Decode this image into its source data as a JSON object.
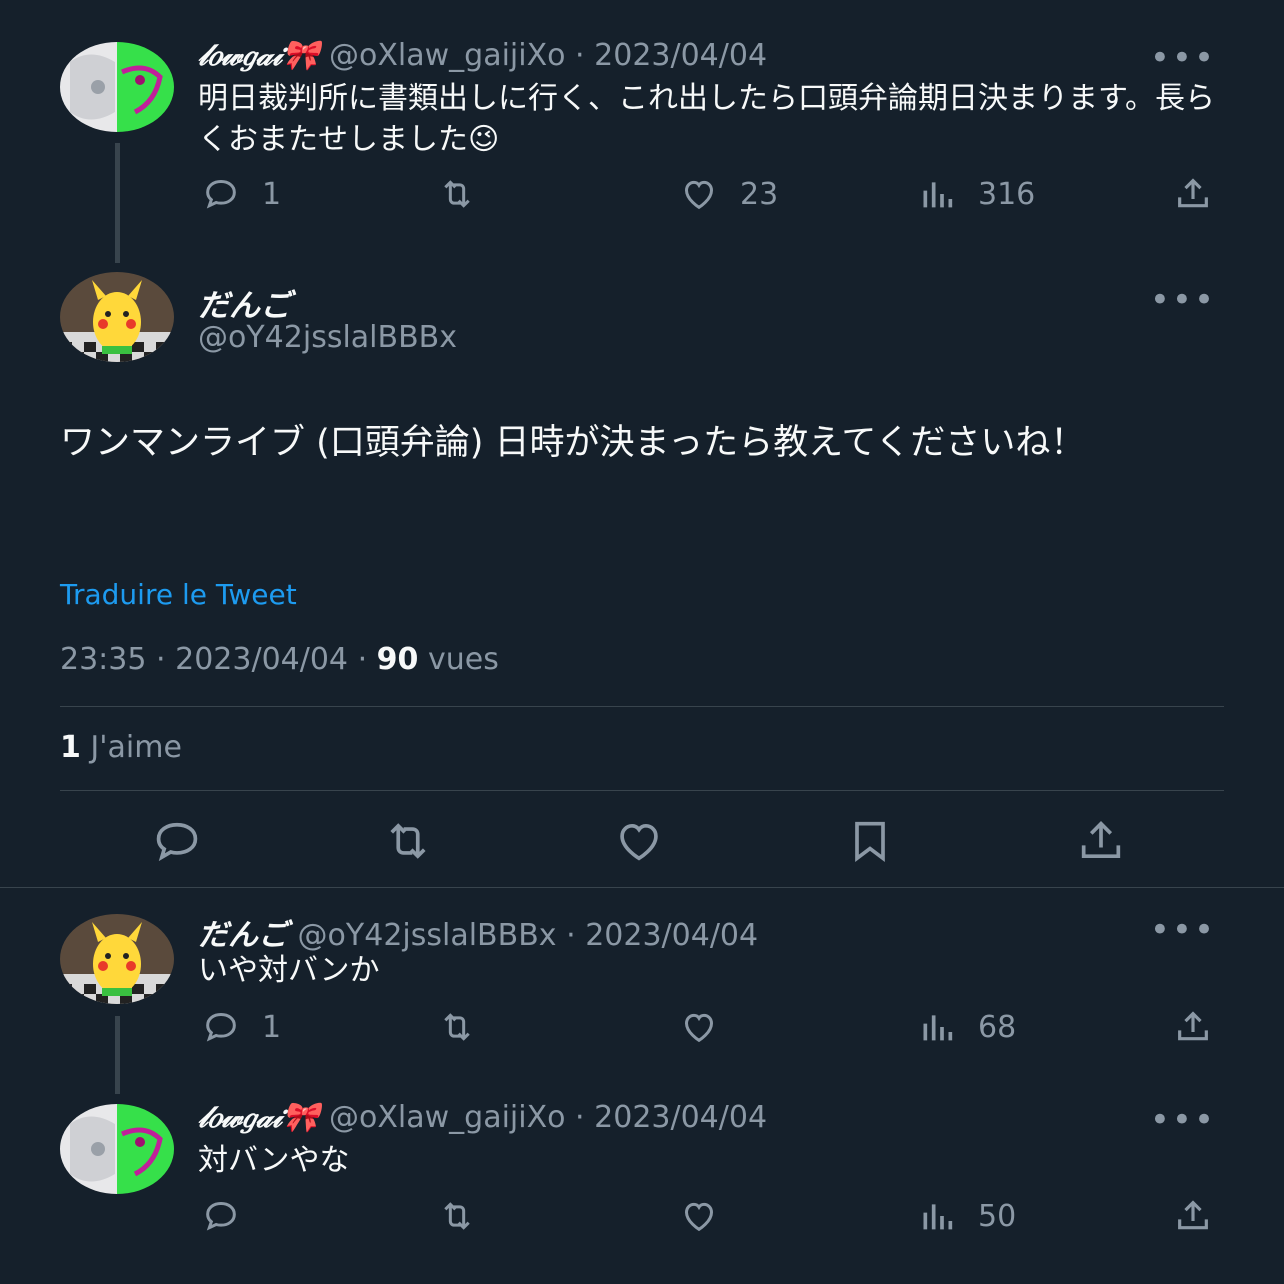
{
  "tweet1": {
    "name": "𝓁𝑜𝓌𝑔𝒶𝒾🎀",
    "handle": "@oXlaw_gaijiXo",
    "date": "2023/04/04",
    "text": "明日裁判所に書類出しに行く、これ出したら口頭弁論期日決まります。長らくおまたせしました😉",
    "replies": "1",
    "retweets": "",
    "likes": "23",
    "views": "316"
  },
  "main": {
    "name": "だんご",
    "handle": "@oY42jsslalBBBx",
    "text": "ワンマンライブ (口頭弁論) 日時が決まったら教えてくださいね！",
    "translate_label": "Traduire le Tweet",
    "time": "23:35",
    "date": "2023/04/04",
    "views_count": "90",
    "views_label": "vues",
    "likes_count": "1",
    "likes_label": "J'aime"
  },
  "reply1": {
    "name": "だんご",
    "handle": "@oY42jsslalBBBx",
    "date": "2023/04/04",
    "text": "いや対バンか",
    "replies": "1",
    "likes": "",
    "views": "68"
  },
  "reply2": {
    "name": "𝓁𝑜𝓌𝑔𝒶𝒾🎀",
    "handle": "@oXlaw_gaijiXo",
    "date": "2023/04/04",
    "text": "対バンやな",
    "replies": "",
    "likes": "",
    "views": "50"
  },
  "ui": {
    "more": "•••",
    "separator": "·"
  },
  "colors": {
    "background": "#15202b",
    "accent": "#1d9bf0",
    "muted": "#8b98a5"
  }
}
